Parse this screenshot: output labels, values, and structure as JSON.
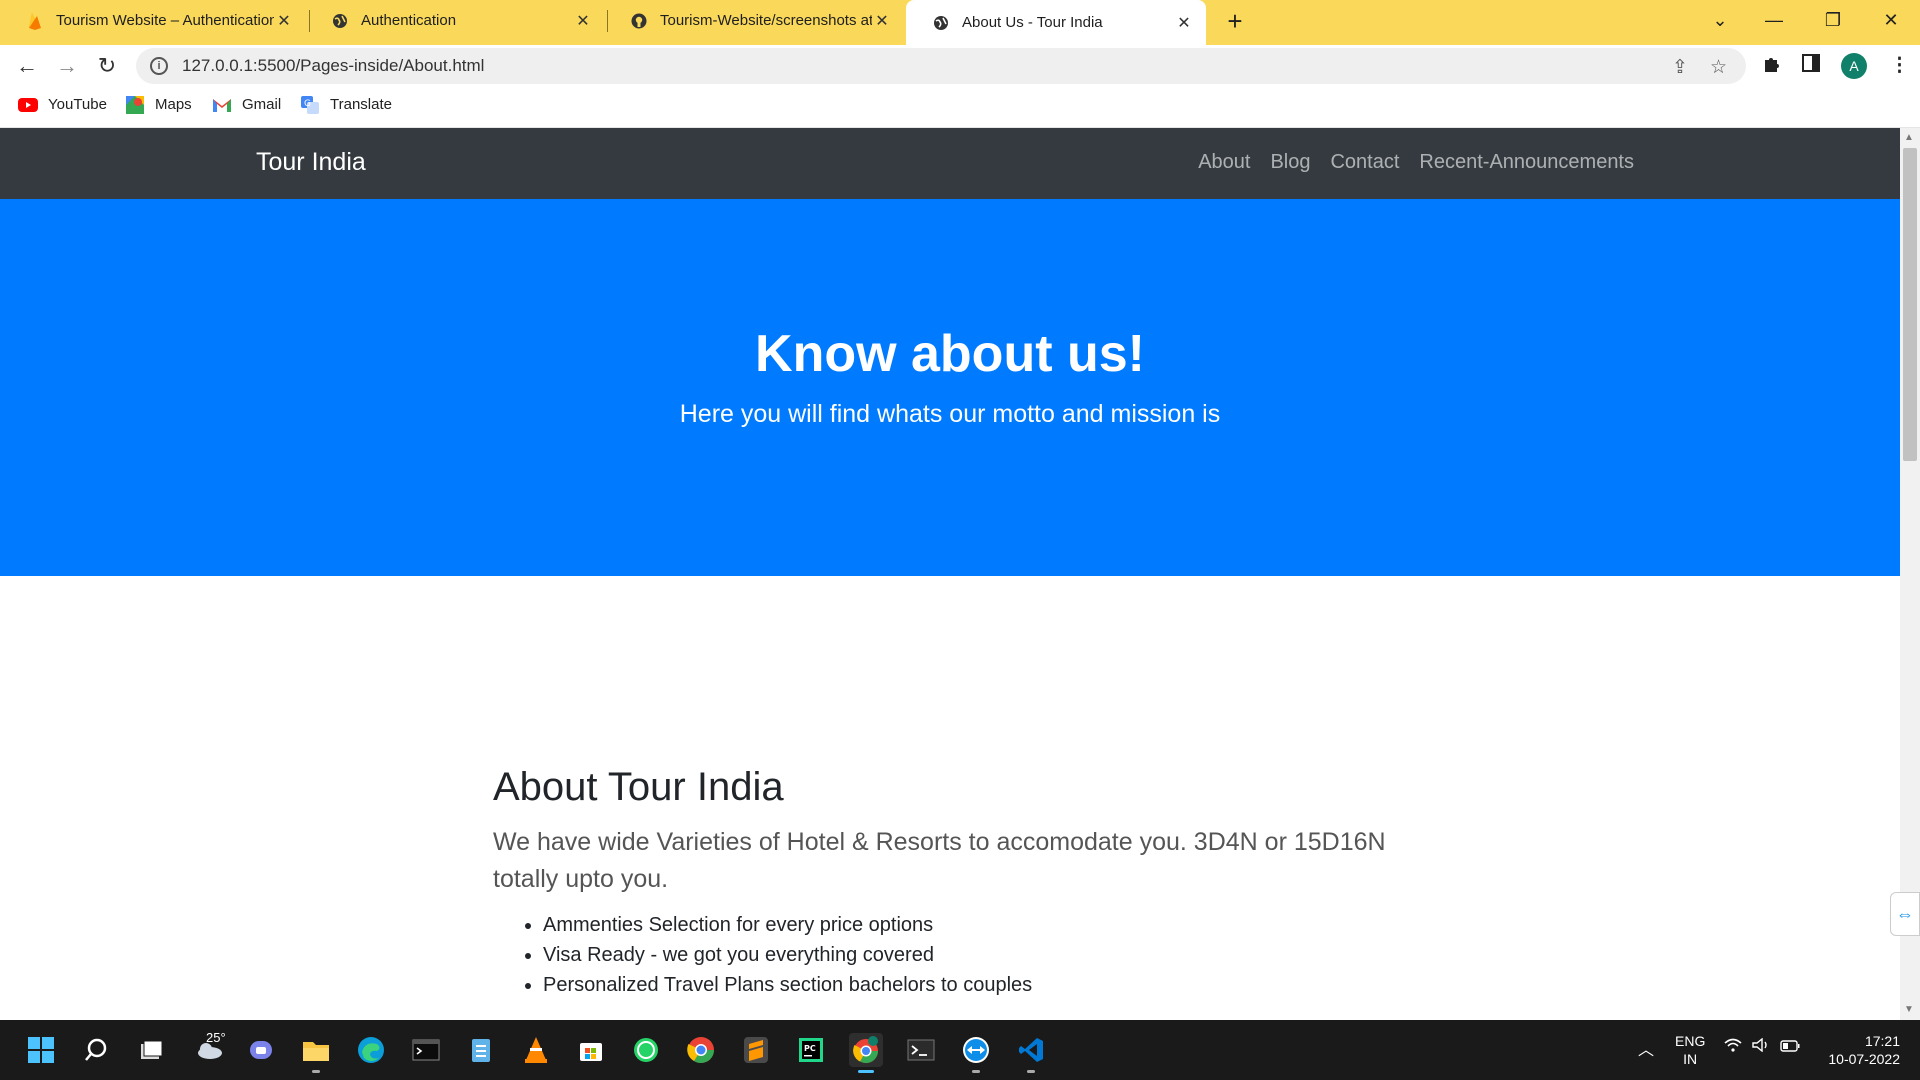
{
  "browser": {
    "tabs": [
      {
        "title": "Tourism Website – Authentication",
        "icon": "firebase-icon"
      },
      {
        "title": "Authentication",
        "icon": "globe-icon"
      },
      {
        "title": "Tourism-Website/screenshots at",
        "icon": "github-icon"
      },
      {
        "title": "About Us - Tour India",
        "icon": "globe-icon",
        "active": true
      }
    ],
    "address": "127.0.0.1:5500/Pages-inside/About.html",
    "profile_initial": "A",
    "bookmarks": [
      {
        "label": "YouTube",
        "icon": "youtube-icon"
      },
      {
        "label": "Maps",
        "icon": "maps-icon"
      },
      {
        "label": "Gmail",
        "icon": "gmail-icon"
      },
      {
        "label": "Translate",
        "icon": "translate-icon"
      }
    ],
    "colors": {
      "tabstrip": "#f9d85a",
      "profile": "#11806a"
    }
  },
  "site": {
    "brand": "Tour India",
    "nav": [
      "About",
      "Blog",
      "Contact",
      "Recent-Announcements"
    ],
    "hero": {
      "title": "Know about us!",
      "subtitle": "Here you will find whats our motto and mission is"
    },
    "about": {
      "heading": "About Tour India",
      "lead": "We have wide Varieties of Hotel & Resorts to accomodate you. 3D4N or 15D16N totally upto you.",
      "items": [
        "Ammenties Selection for every price options",
        "Visa Ready - we got you everything covered",
        "Personalized Travel Plans section bachelors to couples"
      ]
    },
    "colors": {
      "navbar": "#343a40",
      "hero": "#007bff"
    }
  },
  "taskbar": {
    "weather": "25°",
    "language": "ENG",
    "region": "IN",
    "time": "17:21",
    "date": "10-07-2022"
  }
}
